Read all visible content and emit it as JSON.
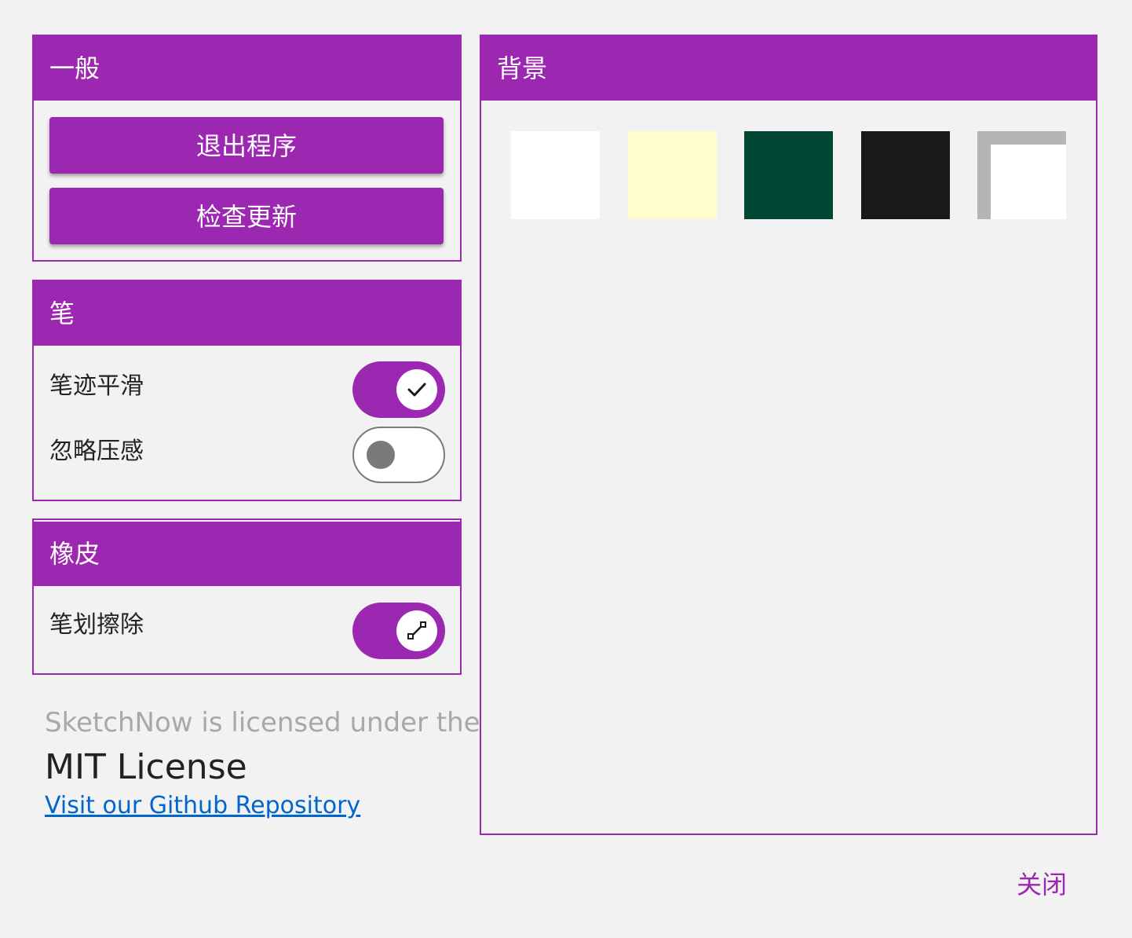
{
  "general": {
    "title": "一般",
    "exit_label": "退出程序",
    "update_label": "检查更新"
  },
  "pen": {
    "title": "笔",
    "smoothing_label": "笔迹平滑",
    "smoothing_on": true,
    "smoothing_icon": "check-icon",
    "ignore_pressure_label": "忽略压感",
    "ignore_pressure_on": false
  },
  "eraser": {
    "title": "橡皮",
    "stroke_erase_label": "笔划擦除",
    "stroke_erase_on": true,
    "stroke_erase_icon": "stroke-erase-icon"
  },
  "background": {
    "title": "背景",
    "swatches": [
      {
        "name": "white",
        "color": "#ffffff"
      },
      {
        "name": "cream",
        "color": "#fffccf"
      },
      {
        "name": "dark-green",
        "color": "#004634"
      },
      {
        "name": "black",
        "color": "#1a1a1a"
      },
      {
        "name": "transparent",
        "color": "#ffffff",
        "border_color": "#b5b5b5"
      }
    ]
  },
  "license": {
    "line1": "SketchNow is licensed under the",
    "line2": "MIT License",
    "link_text": "Visit our Github Repository"
  },
  "close_label": "关闭",
  "colors": {
    "accent": "#9c27b0",
    "background": "#f2f2f2",
    "link": "#0066cc"
  }
}
